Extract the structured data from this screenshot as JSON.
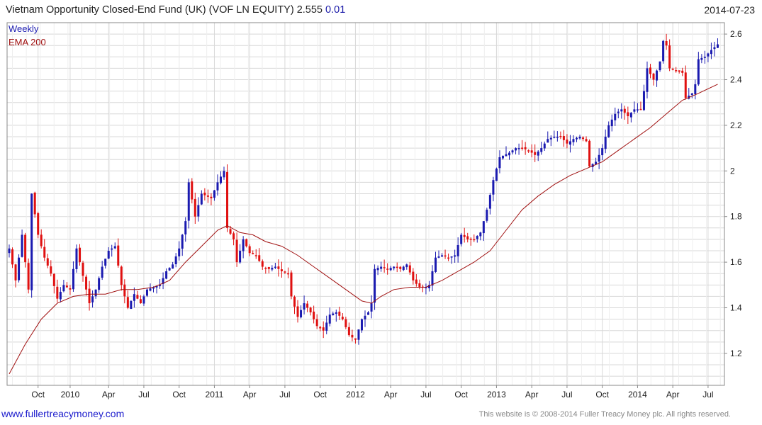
{
  "header": {
    "title": "Vietnam Opportunity Closed-End Fund (UK) (VOF LN EQUITY) 2.555",
    "change": "0.01",
    "date": "2014-07-23"
  },
  "footer": {
    "link": "www.fullertreacymoney.com",
    "copyright": "This website is © 2008-2014 Fuller Treacy Money plc. All rights reserved."
  },
  "colors": {
    "up": "#1a1ab0",
    "down": "#e01010",
    "ema": "#a01010",
    "grid": "#d8d8d8"
  },
  "chart_data": {
    "type": "candlestick",
    "frequency": "Weekly",
    "legend": [
      {
        "name": "Weekly",
        "color": "#1a1ab0"
      },
      {
        "name": "EMA 200",
        "color": "#a01010"
      }
    ],
    "yticks": [
      1.2,
      1.4,
      1.6,
      1.8,
      2,
      2.2,
      2.4,
      2.6
    ],
    "ylim": [
      1.06,
      2.65
    ],
    "xlim": [
      0,
      222
    ],
    "xticks": [
      {
        "label": "Oct",
        "week": 9
      },
      {
        "label": "2010",
        "week": 19
      },
      {
        "label": "Apr",
        "week": 31
      },
      {
        "label": "Jul",
        "week": 42
      },
      {
        "label": "Oct",
        "week": 53
      },
      {
        "label": "2011",
        "week": 64
      },
      {
        "label": "Apr",
        "week": 75
      },
      {
        "label": "Jul",
        "week": 86
      },
      {
        "label": "Oct",
        "week": 97
      },
      {
        "label": "2012",
        "week": 108
      },
      {
        "label": "Apr",
        "week": 119
      },
      {
        "label": "Jul",
        "week": 130
      },
      {
        "label": "Oct",
        "week": 141
      },
      {
        "label": "2013",
        "week": 152
      },
      {
        "label": "Apr",
        "week": 163
      },
      {
        "label": "Jul",
        "week": 174
      },
      {
        "label": "Oct",
        "week": 185
      },
      {
        "label": "2014",
        "week": 196
      },
      {
        "label": "Apr",
        "week": 207
      },
      {
        "label": "Jul",
        "week": 218
      }
    ],
    "close_anchors": [
      [
        0,
        1.66
      ],
      [
        2,
        1.52
      ],
      [
        4,
        1.72
      ],
      [
        6,
        1.48
      ],
      [
        7,
        1.9
      ],
      [
        9,
        1.72
      ],
      [
        11,
        1.62
      ],
      [
        13,
        1.55
      ],
      [
        15,
        1.44
      ],
      [
        17,
        1.5
      ],
      [
        19,
        1.48
      ],
      [
        21,
        1.66
      ],
      [
        23,
        1.54
      ],
      [
        25,
        1.42
      ],
      [
        27,
        1.48
      ],
      [
        29,
        1.58
      ],
      [
        31,
        1.65
      ],
      [
        33,
        1.67
      ],
      [
        35,
        1.5
      ],
      [
        37,
        1.4
      ],
      [
        39,
        1.46
      ],
      [
        41,
        1.42
      ],
      [
        43,
        1.48
      ],
      [
        45,
        1.49
      ],
      [
        47,
        1.5
      ],
      [
        49,
        1.56
      ],
      [
        51,
        1.59
      ],
      [
        53,
        1.66
      ],
      [
        55,
        1.78
      ],
      [
        56,
        1.95
      ],
      [
        58,
        1.8
      ],
      [
        60,
        1.9
      ],
      [
        63,
        1.88
      ],
      [
        65,
        1.95
      ],
      [
        67,
        2.0
      ],
      [
        68,
        1.75
      ],
      [
        70,
        1.7
      ],
      [
        71,
        1.6
      ],
      [
        73,
        1.7
      ],
      [
        75,
        1.64
      ],
      [
        77,
        1.63
      ],
      [
        79,
        1.58
      ],
      [
        81,
        1.57
      ],
      [
        83,
        1.58
      ],
      [
        85,
        1.56
      ],
      [
        87,
        1.55
      ],
      [
        88,
        1.45
      ],
      [
        90,
        1.36
      ],
      [
        92,
        1.42
      ],
      [
        94,
        1.38
      ],
      [
        96,
        1.32
      ],
      [
        98,
        1.3
      ],
      [
        100,
        1.37
      ],
      [
        102,
        1.38
      ],
      [
        104,
        1.35
      ],
      [
        106,
        1.28
      ],
      [
        108,
        1.26
      ],
      [
        110,
        1.35
      ],
      [
        112,
        1.38
      ],
      [
        113,
        1.42
      ],
      [
        114,
        1.57
      ],
      [
        116,
        1.58
      ],
      [
        118,
        1.57
      ],
      [
        120,
        1.58
      ],
      [
        122,
        1.57
      ],
      [
        124,
        1.59
      ],
      [
        126,
        1.52
      ],
      [
        128,
        1.49
      ],
      [
        130,
        1.49
      ],
      [
        131,
        1.5
      ],
      [
        133,
        1.62
      ],
      [
        135,
        1.63
      ],
      [
        137,
        1.62
      ],
      [
        139,
        1.63
      ],
      [
        141,
        1.72
      ],
      [
        143,
        1.7
      ],
      [
        145,
        1.7
      ],
      [
        147,
        1.73
      ],
      [
        149,
        1.83
      ],
      [
        151,
        1.96
      ],
      [
        153,
        2.06
      ],
      [
        156,
        2.08
      ],
      [
        158,
        2.1
      ],
      [
        160,
        2.1
      ],
      [
        162,
        2.09
      ],
      [
        164,
        2.07
      ],
      [
        166,
        2.1
      ],
      [
        168,
        2.14
      ],
      [
        170,
        2.15
      ],
      [
        172,
        2.15
      ],
      [
        174,
        2.12
      ],
      [
        176,
        2.14
      ],
      [
        178,
        2.15
      ],
      [
        180,
        2.13
      ],
      [
        181,
        2.02
      ],
      [
        183,
        2.04
      ],
      [
        185,
        2.1
      ],
      [
        187,
        2.2
      ],
      [
        189,
        2.25
      ],
      [
        191,
        2.27
      ],
      [
        193,
        2.24
      ],
      [
        195,
        2.27
      ],
      [
        197,
        2.27
      ],
      [
        198,
        2.35
      ],
      [
        199,
        2.45
      ],
      [
        201,
        2.4
      ],
      [
        203,
        2.48
      ],
      [
        204,
        2.57
      ],
      [
        205,
        2.55
      ],
      [
        206,
        2.45
      ],
      [
        208,
        2.44
      ],
      [
        210,
        2.43
      ],
      [
        211,
        2.32
      ],
      [
        213,
        2.34
      ],
      [
        214,
        2.38
      ],
      [
        215,
        2.49
      ],
      [
        217,
        2.5
      ],
      [
        219,
        2.53
      ],
      [
        221,
        2.555
      ]
    ],
    "ema_200": [
      [
        0,
        1.11
      ],
      [
        5,
        1.24
      ],
      [
        10,
        1.35
      ],
      [
        15,
        1.42
      ],
      [
        20,
        1.45
      ],
      [
        25,
        1.46
      ],
      [
        30,
        1.46
      ],
      [
        35,
        1.48
      ],
      [
        40,
        1.48
      ],
      [
        45,
        1.49
      ],
      [
        50,
        1.52
      ],
      [
        55,
        1.6
      ],
      [
        60,
        1.67
      ],
      [
        65,
        1.74
      ],
      [
        68,
        1.76
      ],
      [
        72,
        1.73
      ],
      [
        76,
        1.72
      ],
      [
        80,
        1.69
      ],
      [
        85,
        1.67
      ],
      [
        90,
        1.63
      ],
      [
        95,
        1.58
      ],
      [
        100,
        1.53
      ],
      [
        105,
        1.48
      ],
      [
        110,
        1.43
      ],
      [
        113,
        1.42
      ],
      [
        116,
        1.45
      ],
      [
        120,
        1.48
      ],
      [
        125,
        1.49
      ],
      [
        130,
        1.49
      ],
      [
        135,
        1.52
      ],
      [
        140,
        1.56
      ],
      [
        145,
        1.6
      ],
      [
        150,
        1.65
      ],
      [
        155,
        1.74
      ],
      [
        160,
        1.83
      ],
      [
        165,
        1.89
      ],
      [
        170,
        1.94
      ],
      [
        175,
        1.98
      ],
      [
        180,
        2.01
      ],
      [
        185,
        2.04
      ],
      [
        190,
        2.09
      ],
      [
        195,
        2.14
      ],
      [
        200,
        2.19
      ],
      [
        205,
        2.25
      ],
      [
        210,
        2.31
      ],
      [
        215,
        2.34
      ],
      [
        221,
        2.38
      ]
    ]
  }
}
